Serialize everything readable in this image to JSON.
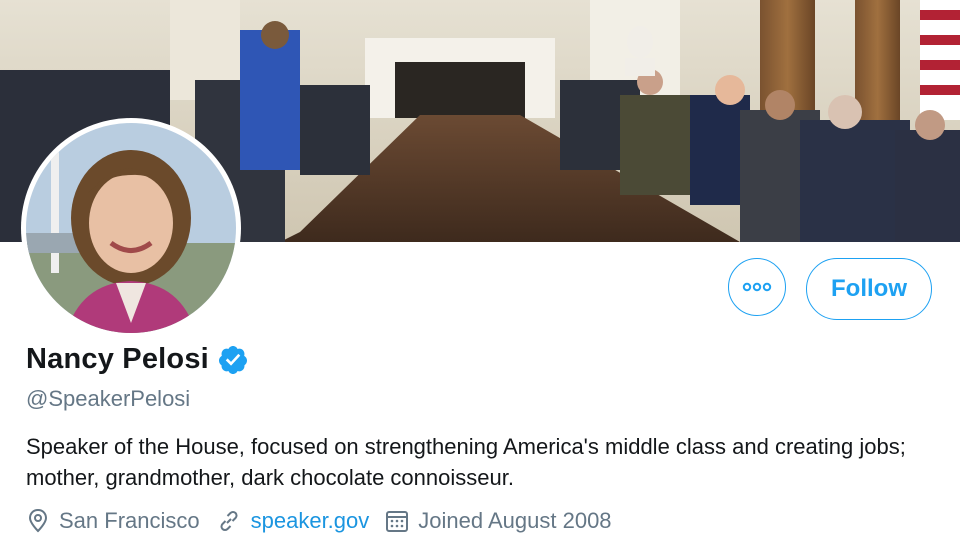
{
  "profile": {
    "name": "Nancy Pelosi",
    "handle": "@SpeakerPelosi",
    "verified": true,
    "bio": "Speaker of the House, focused on strengthening America's middle class and creating jobs; mother, grandmother, dark chocolate connoisseur.",
    "location": "San Francisco",
    "website": "speaker.gov",
    "joined": "Joined August 2008"
  },
  "actions": {
    "more_icon": "more-horizontal-icon",
    "follow_label": "Follow"
  },
  "icons": {
    "location": "location-pin-icon",
    "link": "link-icon",
    "calendar": "calendar-icon",
    "verified": "verified-badge-icon"
  },
  "colors": {
    "accent": "#1da1f2",
    "link": "#1b95e0",
    "secondary_text": "#657786",
    "primary_text": "#14171a"
  }
}
